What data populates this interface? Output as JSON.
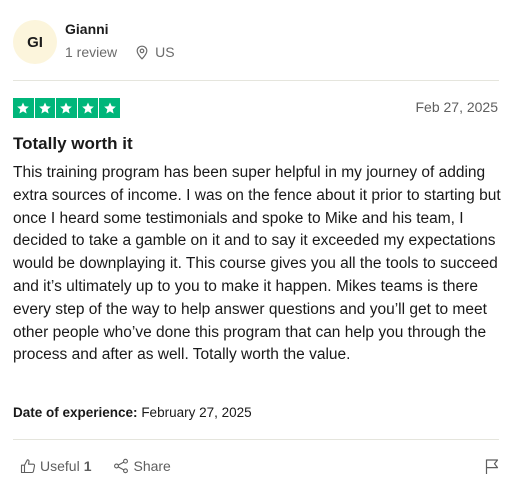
{
  "reviewer": {
    "initials": "GI",
    "name": "Gianni",
    "review_count": "1 review",
    "country": "US"
  },
  "review": {
    "rating": 5,
    "rating_max": 5,
    "date": "Feb 27, 2025",
    "title": "Totally worth it",
    "body": "This training program has been super helpful in my journey of adding extra sources of income. I was on the fence about it prior to starting but once I heard some testimonials and spoke to Mike and his team, I decided to take a gamble on it and to say it exceeded my expectations would be downplaying it. This course gives you all the tools to succeed and it’s ultimately up to you to make it happen. Mikes teams is there every step of the way to help answer questions and you’ll get to meet other people who’ve done this program that can help you through the process and after as well. Totally worth the value.",
    "experience_label": "Date of experience:",
    "experience_date": "February 27, 2025"
  },
  "actions": {
    "useful_label": "Useful",
    "useful_count": "1",
    "share_label": "Share"
  },
  "colors": {
    "star_green": "#00b67a",
    "avatar_bg": "#fcf5dc",
    "muted_text": "#6b6b6b"
  },
  "icons": {
    "location": "location-pin-icon",
    "star": "star-icon",
    "thumbs_up": "thumbs-up-icon",
    "share": "share-icon",
    "flag": "flag-icon"
  }
}
